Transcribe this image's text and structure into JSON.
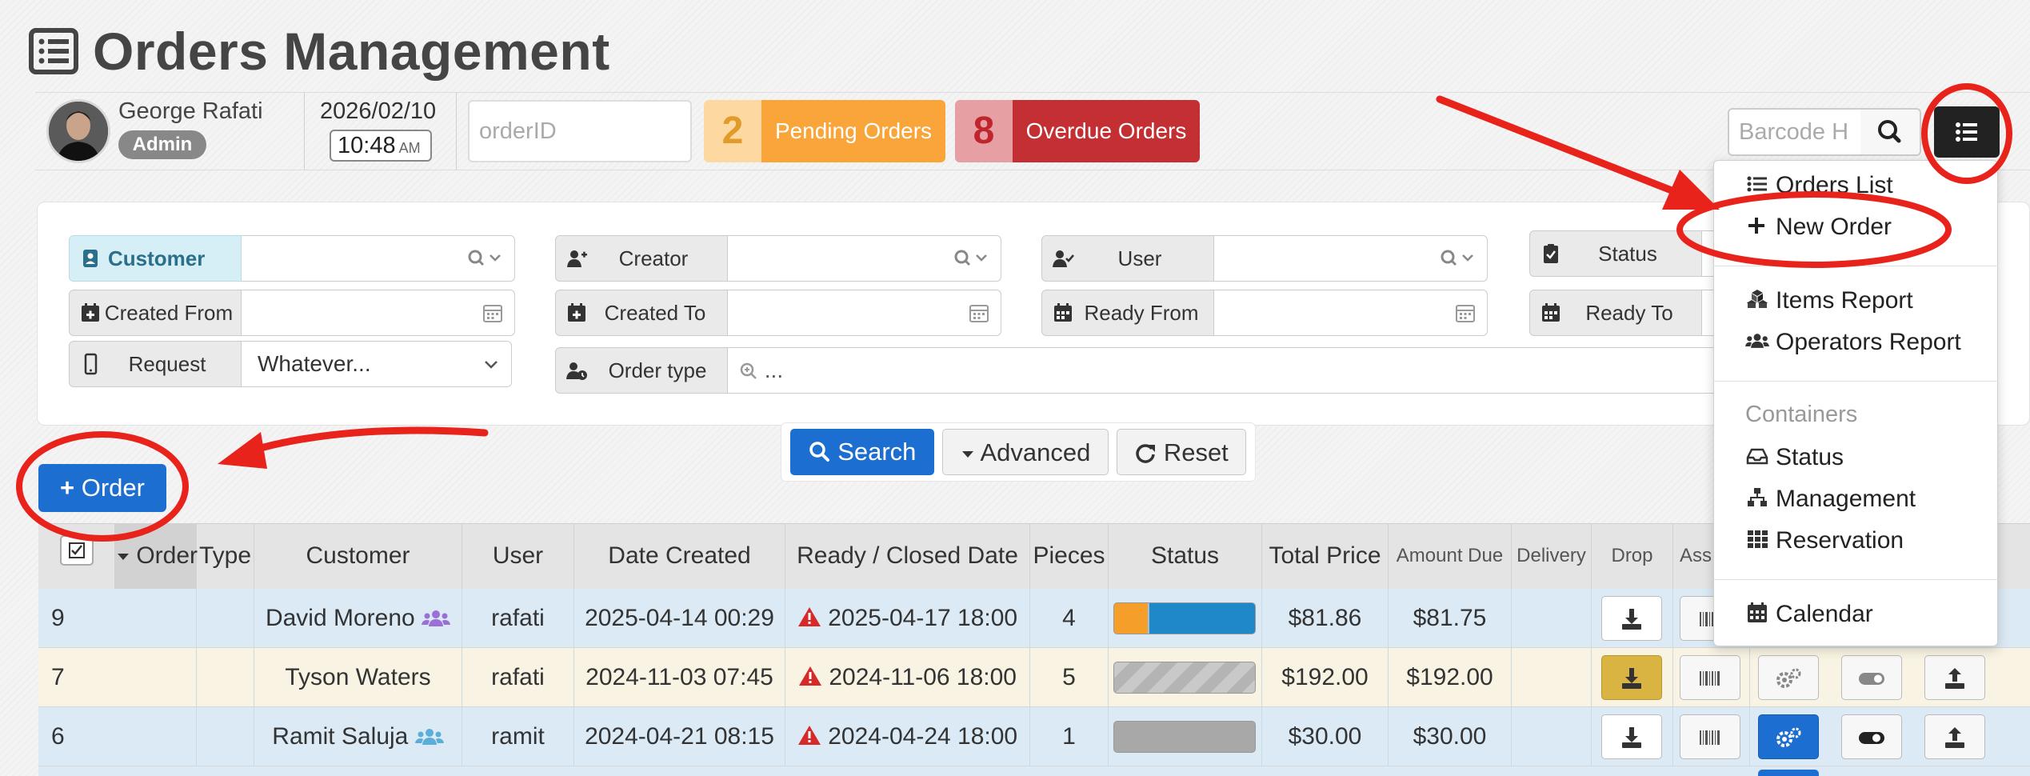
{
  "page": {
    "title": "Orders Management"
  },
  "user": {
    "name": "George Rafati",
    "role": "Admin"
  },
  "datetime": {
    "date": "2026/02/10",
    "time": "10:48",
    "ampm": "AM"
  },
  "order_id": {
    "placeholder": "orderID"
  },
  "pending": {
    "count": "2",
    "label": "Pending Orders"
  },
  "overdue": {
    "count": "8",
    "label": "Overdue Orders"
  },
  "barcode": {
    "placeholder": "Barcode H"
  },
  "filters": {
    "customer": "Customer",
    "creator": "Creator",
    "user": "User",
    "status": "Status",
    "created_from": "Created From",
    "created_to": "Created To",
    "ready_from": "Ready From",
    "ready_to": "Ready To",
    "request": "Request",
    "request_value": "Whatever...",
    "order_type": "Order type",
    "order_type_value": "..."
  },
  "buttons": {
    "search": "Search",
    "advanced": "Advanced",
    "reset": "Reset",
    "new_order": "Order"
  },
  "table": {
    "headers": {
      "order": "Order",
      "type": "Type",
      "customer": "Customer",
      "user": "User",
      "date_created": "Date Created",
      "ready_closed": "Ready / Closed Date",
      "pieces": "Pieces",
      "status": "Status",
      "total_price": "Total Price",
      "amount_due": "Amount Due",
      "delivery": "Delivery",
      "drop": "Drop",
      "assign": "Ass"
    },
    "rows": [
      {
        "order": "9",
        "customer": "David Moreno",
        "user": "rafati",
        "date_created": "2025-04-14 00:29",
        "ready": "2025-04-17 18:00",
        "pieces": "4",
        "total": "$81.86",
        "due": "$81.75",
        "status_fill": 0.25
      },
      {
        "order": "7",
        "customer": "Tyson Waters",
        "user": "rafati",
        "date_created": "2024-11-03 07:45",
        "ready": "2024-11-06 18:00",
        "pieces": "5",
        "total": "$192.00",
        "due": "$192.00",
        "status_fill": 0
      },
      {
        "order": "6",
        "customer": "Ramit Saluja",
        "user": "ramit",
        "date_created": "2024-04-21 08:15",
        "ready": "2024-04-24 18:00",
        "pieces": "1",
        "total": "$30.00",
        "due": "$30.00",
        "status_fill": 0
      }
    ]
  },
  "menu": {
    "orders_list": "Orders List",
    "new_order": "New Order",
    "items_report": "Items Report",
    "operators_report": "Operators Report",
    "containers_header": "Containers",
    "status": "Status",
    "management": "Management",
    "reservation": "Reservation",
    "calendar": "Calendar"
  },
  "colors": {
    "primary": "#1c6fd1",
    "pending": "#f9a53a",
    "overdue": "#c32f33",
    "annotation": "#e8231b",
    "row_blue": "#dbeaf5",
    "row_cream": "#f8f3e2"
  }
}
